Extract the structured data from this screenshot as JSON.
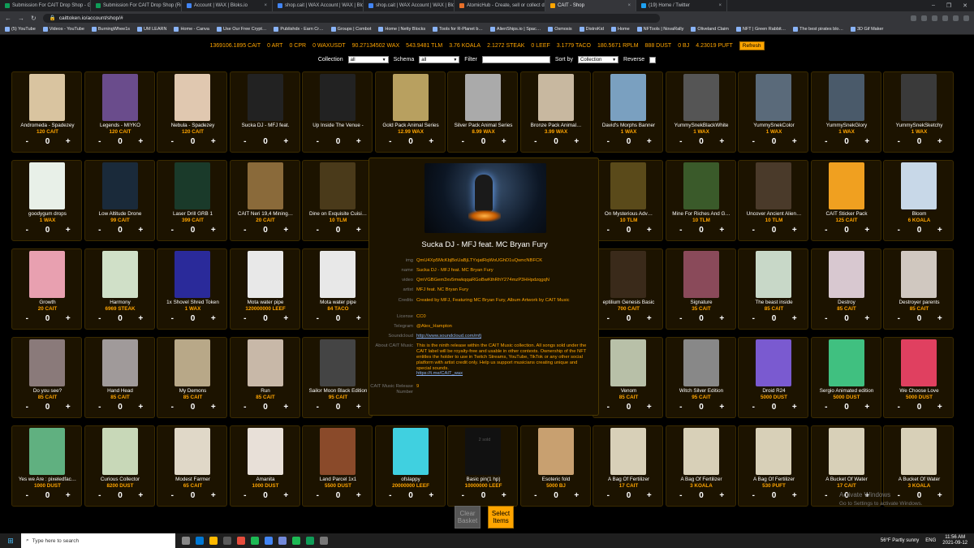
{
  "browser": {
    "tabs": [
      {
        "label": "Submission For CAIT Drop Shop - Goo",
        "color": "#0f9d58",
        "active": false
      },
      {
        "label": "Submission For CAIT Drop Shop (Re…",
        "color": "#0f9d58",
        "active": false
      },
      {
        "label": "Account | WAX | Bloks.io",
        "color": "#4285f4",
        "active": false
      },
      {
        "label": "shop.cait | WAX Account | WAX | Blok…",
        "color": "#4285f4",
        "active": false
      },
      {
        "label": "shop.cait | WAX Account | WAX | Blok…",
        "color": "#4285f4",
        "active": false
      },
      {
        "label": "AtomicHub - Create, sell or collect dig…",
        "color": "#e8702a",
        "active": false
      },
      {
        "label": "CAIT - Shop",
        "color": "#ffa500",
        "active": true
      },
      {
        "label": "(19) Home / Twitter",
        "color": "#1da1f2",
        "active": false
      }
    ],
    "url": "caittoken.io/account/shop/#",
    "bookmarks": [
      "(5) YouTube",
      "Videos - YouTube",
      "BurningWhee1s",
      "UM LEARN",
      "Home - Canva",
      "Use Our Free Crypt…",
      "Publishdx - Earn Cr…",
      "Groups | Combot",
      "Home | Netty Blocks",
      "Tools for R-Planet b…",
      "AlienShips.io | Spac…",
      "Osmosis",
      "DistroKid",
      "Home",
      "NFTools | NovaRally",
      "Oliveland Claim",
      "NFT | Green Rabbit…",
      "The best pirates blo…",
      "3D Gif Maker"
    ]
  },
  "balances": [
    "1369106.1895 CAIT",
    "0 ART",
    "0 CPR",
    "0 WAXUSDT",
    "90.27134502 WAX",
    "543.9481 TLM",
    "3.76 KOALA",
    "2.1272 STEAK",
    "0 LEEF",
    "3.1779 TACO",
    "180.5671 RPLM",
    "888 DUST",
    "0 BJ",
    "4.23019 PUFT"
  ],
  "refresh_label": "Refresh",
  "filters": {
    "collection_label": "Collection",
    "collection_value": "all",
    "schema_label": "Schema",
    "schema_value": "all",
    "filter_label": "Filter",
    "sort_label": "Sort by",
    "sort_value": "Collection",
    "reverse_label": "Reverse"
  },
  "qty_minus": "-",
  "qty_plus": "+",
  "cards": [
    {
      "name": "Andromeda - Spadezey",
      "price": "120 CAIT",
      "qty": "0",
      "color": "#d9c4a0"
    },
    {
      "name": "Legends - MIYKO",
      "price": "120 CAIT",
      "qty": "0",
      "color": "#6a4c8c"
    },
    {
      "name": "Nebula - Spadezey",
      "price": "120 CAIT",
      "qty": "0",
      "color": "#e0c8b0"
    },
    {
      "name": "Sucka DJ - MFJ feat.",
      "price": "",
      "qty": "0",
      "color": "#222222"
    },
    {
      "name": "Up Inside The Venue -",
      "price": "",
      "qty": "0",
      "color": "#222222"
    },
    {
      "name": "Gold Pack Animal Series",
      "price": "12.99 WAX",
      "qty": "0",
      "color": "#b8a060"
    },
    {
      "name": "Silver Pack Animal Series",
      "price": "8.99 WAX",
      "qty": "0",
      "color": "#aaaaaa"
    },
    {
      "name": "Bronze Pack Animal…",
      "price": "3.99 WAX",
      "qty": "0",
      "color": "#c8b8a0"
    },
    {
      "name": "David's Morphs Banner",
      "price": "1 WAX",
      "qty": "0",
      "color": "#7aa0c0"
    },
    {
      "name": "YummySnekBlackWhite",
      "price": "1 WAX",
      "qty": "0",
      "color": "#555555"
    },
    {
      "name": "YummySnekColor",
      "price": "1 WAX",
      "qty": "0",
      "color": "#5a6a7a"
    },
    {
      "name": "YummySnekGlory",
      "price": "1 WAX",
      "qty": "0",
      "color": "#4a5a6a"
    },
    {
      "name": "YummySnekSketchy",
      "price": "1 WAX",
      "qty": "0",
      "color": "#3a3a3a"
    },
    {
      "name": "goodygum drops",
      "price": "1 WAX",
      "qty": "0",
      "color": "#e8f0e8"
    },
    {
      "name": "Low Altitude Drone",
      "price": "99 CAIT",
      "qty": "0",
      "color": "#1a2a3a"
    },
    {
      "name": "Laser Drill GRB 1",
      "price": "399 CAIT",
      "qty": "0",
      "color": "#1a3a2a"
    },
    {
      "name": "CAIT Neri 19,4 Mining…",
      "price": "20 CAIT",
      "qty": "0",
      "color": "#8a6a3a"
    },
    {
      "name": "Dine on Exquisite Cuisi…",
      "price": "10 TLM",
      "qty": "0",
      "color": "#4a3a1a"
    },
    {
      "name": "",
      "price": "",
      "qty": "",
      "color": "#000000"
    },
    {
      "name": "",
      "price": "",
      "qty": "",
      "color": "#000000"
    },
    {
      "name": "",
      "price": "",
      "qty": "",
      "color": "#000000"
    },
    {
      "name": "On Mysterious Adv…",
      "price": "10 TLM",
      "qty": "0",
      "color": "#5a4a1a"
    },
    {
      "name": "Mine For Riches And G…",
      "price": "10 TLM",
      "qty": "0",
      "color": "#3a5a2a"
    },
    {
      "name": "Uncover Ancient Alien…",
      "price": "10 TLM",
      "qty": "0",
      "color": "#4a3a2a"
    },
    {
      "name": "CAIT Sticker Pack",
      "price": "125 CAIT",
      "qty": "0",
      "color": "#f0a020"
    },
    {
      "name": "Bloom",
      "price": "6 KOALA",
      "qty": "0",
      "color": "#c8d8e8"
    },
    {
      "name": "Growth",
      "price": "20 CAIT",
      "qty": "0",
      "color": "#e8a0b0"
    },
    {
      "name": "Harmony",
      "price": "6969 STEAK",
      "qty": "0",
      "color": "#d0e0c8"
    },
    {
      "name": "1x Shovel Shred Token",
      "price": "1 WAX",
      "qty": "0",
      "color": "#2a2a9a"
    },
    {
      "name": "Mota water pipe",
      "price": "120000000 LEEF",
      "qty": "0",
      "color": "#e8e8e8"
    },
    {
      "name": "Mota water pipe",
      "price": "84 TACO",
      "qty": "0",
      "color": "#e8e8e8"
    },
    {
      "name": "",
      "price": "",
      "qty": "",
      "color": "#000000"
    },
    {
      "name": "",
      "price": "",
      "qty": "",
      "color": "#000000"
    },
    {
      "name": "",
      "price": "",
      "qty": "",
      "color": "#000000"
    },
    {
      "name": "eptilium Genesis Basic",
      "price": "700 CAIT",
      "qty": "0",
      "color": "#3a2a1a"
    },
    {
      "name": "Signature",
      "price": "35 CAIT",
      "qty": "0",
      "color": "#8a4a5a"
    },
    {
      "name": "The beast inside",
      "price": "85 CAIT",
      "qty": "0",
      "color": "#c8d8c8"
    },
    {
      "name": "Destroy",
      "price": "85 CAIT",
      "qty": "0",
      "color": "#d8c8d0"
    },
    {
      "name": "Destroyer parents",
      "price": "85 CAIT",
      "qty": "0",
      "color": "#d0c8c0"
    },
    {
      "name": "Do you see?",
      "price": "85 CAIT",
      "qty": "0",
      "color": "#8a7a7a"
    },
    {
      "name": "Hand Head",
      "price": "85 CAIT",
      "qty": "0",
      "color": "#a09a9a"
    },
    {
      "name": "My Demons",
      "price": "85 CAIT",
      "qty": "0",
      "color": "#b8a888"
    },
    {
      "name": "Run",
      "price": "85 CAIT",
      "qty": "0",
      "color": "#c8b8a8"
    },
    {
      "name": "Sailor Moon Black Edition",
      "price": "95 CAIT",
      "qty": "0",
      "color": "#444444"
    },
    {
      "name": "",
      "price": "",
      "qty": "",
      "color": "#000000"
    },
    {
      "name": "",
      "price": "",
      "qty": "",
      "color": "#000000"
    },
    {
      "name": "",
      "price": "",
      "qty": "",
      "color": "#000000"
    },
    {
      "name": "Venom",
      "price": "85 CAIT",
      "qty": "0",
      "color": "#b8c0a8"
    },
    {
      "name": "Witch Silver Edition",
      "price": "95 CAIT",
      "qty": "0",
      "color": "#888888"
    },
    {
      "name": "Droid R24",
      "price": "5000 DUST",
      "qty": "0",
      "color": "#7a5ad0"
    },
    {
      "name": "Sergio Animated edition",
      "price": "5000 DUST",
      "qty": "0",
      "color": "#40c080"
    },
    {
      "name": "We Choose Love",
      "price": "5000 DUST",
      "qty": "0",
      "color": "#e04060"
    },
    {
      "name": "Yes we Are : pixeledfac…",
      "price": "1000 DUST",
      "qty": "0",
      "color": "#60b080"
    },
    {
      "name": "Curious Collector",
      "price": "8200 DUST",
      "qty": "0",
      "color": "#c8d8b8"
    },
    {
      "name": "Modest Farmer",
      "price": "65 CAIT",
      "qty": "0",
      "color": "#e0d8c8"
    },
    {
      "name": "Amanita",
      "price": "1000 DUST",
      "qty": "0",
      "color": "#e8e0d8"
    },
    {
      "name": "Land Parcel 1x1",
      "price": "5500 DUST",
      "qty": "0",
      "color": "#8a4a2a"
    },
    {
      "name": "ofslappy",
      "price": "20000000 LEEF",
      "qty": "0",
      "color": "#40d0e0"
    },
    {
      "name": "Basic pin(1 hp)",
      "price": "10000000 LEEF",
      "qty": "0",
      "color": "#111111"
    },
    {
      "name": "Esoteric fold",
      "price": "5000 BJ",
      "qty": "0",
      "color": "#c8a070"
    },
    {
      "name": "A Bag Of Fertilizer",
      "price": "17 CAIT",
      "qty": "0",
      "color": "#d8d0b8"
    },
    {
      "name": "A Bag Of Fertilizer",
      "price": "3 KOALA",
      "qty": "0",
      "color": "#d8d0b8"
    },
    {
      "name": "A Bag Of Fertilizer",
      "price": "530 PUFT",
      "qty": "0",
      "color": "#d8d0b8"
    },
    {
      "name": "A Bucket Of Water",
      "price": "17 CAIT",
      "qty": "0",
      "color": "#d8d0b8"
    },
    {
      "name": "A Bucket Of Water",
      "price": "3 KOALA",
      "qty": "0",
      "color": "#d8d0b8"
    }
  ],
  "tooltip": {
    "title": "Sucka DJ - MFJ feat. MC Bryan Fury",
    "rows": [
      {
        "key": "img",
        "value": "QmU4Xp5McKbjBoUaBjLTYxjatRqWoUGhD1uQwncNBFCK",
        "link": false
      },
      {
        "key": "name",
        "value": "Sucka DJ - MFJ feat. MC Bryan Fury",
        "link": false
      },
      {
        "key": "video",
        "value": "QmVGBGem3xv5mwkqqaRGoBwKthRhY274mzP3HHpdzqgqN",
        "link": false
      },
      {
        "key": "artist",
        "value": "MFJ feat. NC Bryan Fury",
        "link": false
      },
      {
        "key": "Credits",
        "value": "Created by MFJ, Featuring MC Bryan Fury, Album Artwork by CAIT Music",
        "link": false
      },
      {
        "key": "License",
        "value": "CC0",
        "link": false
      },
      {
        "key": "Telegram",
        "value": "@Alex_Hampton",
        "link": false
      },
      {
        "key": "Soundcloud",
        "value": "http://www.soundcloud.com/mfj",
        "link": true
      },
      {
        "key": "About CAIT Music",
        "value": "This is the ninth release within the CAIT Music collection. All songs sold under the CAIT label will be royalty-free and usable in other contexts. Ownership of the NFT entitles the holder to use in Twitch Streams, YouTube, TikTok or any other social platform with artist credit only. Help us support musicians creating unique and special sounds.",
        "link": false
      },
      {
        "key": "",
        "value": "https://t.me/CAIT_wax",
        "link": true
      },
      {
        "key": "CAIT Music Release Number",
        "value": "9",
        "link": false
      }
    ],
    "sold": "2 sold"
  },
  "bottom": {
    "clear_label": "Clear Basket",
    "select_label": "Select Items"
  },
  "watermark": {
    "title": "Activate Windows",
    "subtitle": "Go to Settings to activate Windows."
  },
  "taskbar": {
    "search_placeholder": "Type here to search",
    "weather": "56°F  Partly sunny",
    "lang": "ENG",
    "time": "11:56 AM",
    "date": "2021-09-12"
  }
}
